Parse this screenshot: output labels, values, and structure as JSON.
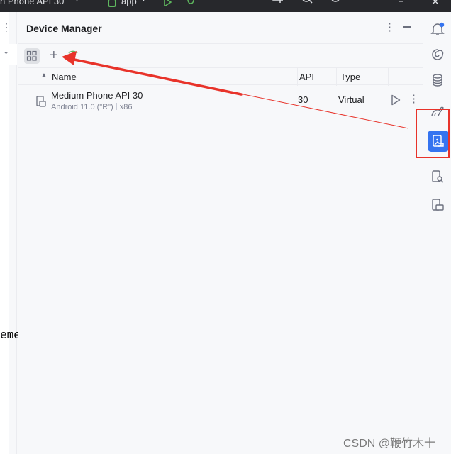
{
  "topbar": {
    "project_label": "n Phone API 30",
    "module_label": "app"
  },
  "left_editor": {
    "code_fragment": "eme"
  },
  "device_manager": {
    "title": "Device Manager",
    "table": {
      "columns": [
        "Name",
        "API",
        "Type"
      ],
      "rows": [
        {
          "name": "Medium Phone API 30",
          "android": "Android 11.0 (\"R\")",
          "abi": "x86",
          "api": "30",
          "type": "Virtual"
        }
      ]
    }
  },
  "right_strip": {
    "icons": [
      "notifications-icon",
      "ai-assistant-icon",
      "database-icon",
      "gradle-icon",
      "device-manager-icon",
      "device-explorer-icon",
      "running-devices-icon"
    ],
    "active_icon": "device-manager-icon"
  },
  "annotations": {
    "color": "#e8332a"
  },
  "watermark": "CSDN @鞭竹木十",
  "colors": {
    "accent": "#3574f0",
    "run_green": "#5fb85f",
    "panel_bg": "#f7f8fa"
  }
}
